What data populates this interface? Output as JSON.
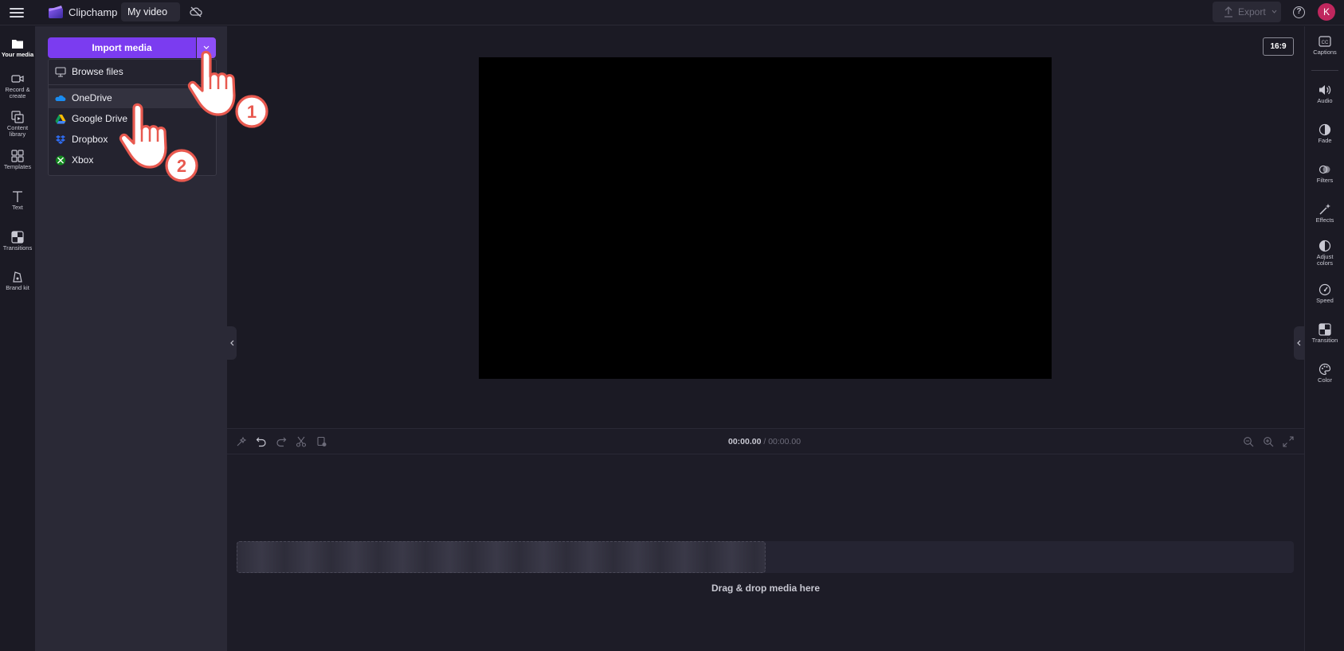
{
  "app": {
    "brand_name": "Clipchamp",
    "project_title": "My video",
    "export_label": "Export",
    "help_label": "?",
    "avatar_initial": "K"
  },
  "left_rail": {
    "items": [
      {
        "label": "Your media",
        "icon": "folder-icon",
        "active": true
      },
      {
        "label": "Record &",
        "label2": "create",
        "icon": "camera-icon"
      },
      {
        "label": "Content",
        "label2": "library",
        "icon": "library-icon"
      },
      {
        "label": "Templates",
        "icon": "templates-icon"
      },
      {
        "label": "Text",
        "icon": "text-icon"
      },
      {
        "label": "Transitions",
        "icon": "transitions-icon"
      },
      {
        "label": "Brand kit",
        "icon": "brand-kit-icon"
      }
    ]
  },
  "media_panel": {
    "import_label": "Import media",
    "dropdown": {
      "browse_files": "Browse files",
      "onedrive": "OneDrive",
      "google_drive": "Google Drive",
      "dropbox": "Dropbox",
      "xbox": "Xbox"
    }
  },
  "preview": {
    "aspect_ratio": "16:9"
  },
  "timeline": {
    "current_time": "00:00.00",
    "separator_total": " / 00:00.00",
    "drop_text": "Drag & drop media here"
  },
  "right_rail": {
    "items": [
      {
        "label": "Captions",
        "icon": "captions-icon"
      },
      {
        "label": "Audio",
        "icon": "speaker-icon"
      },
      {
        "label": "Fade",
        "icon": "fade-icon"
      },
      {
        "label": "Filters",
        "icon": "filters-icon"
      },
      {
        "label": "Effects",
        "icon": "magic-wand-icon"
      },
      {
        "label": "Adjust",
        "label2": "colors",
        "icon": "adjust-colors-icon"
      },
      {
        "label": "Speed",
        "icon": "speedometer-icon"
      },
      {
        "label": "Transition",
        "icon": "transition-icon"
      },
      {
        "label": "Color",
        "icon": "palette-icon"
      }
    ]
  },
  "annotations": {
    "step1": "1",
    "step2": "2"
  },
  "colors": {
    "accent": "#7b3cf0",
    "accent_dropdown": "#8e4ff8",
    "avatar": "#c0275e",
    "annotation": "#e8594f"
  }
}
